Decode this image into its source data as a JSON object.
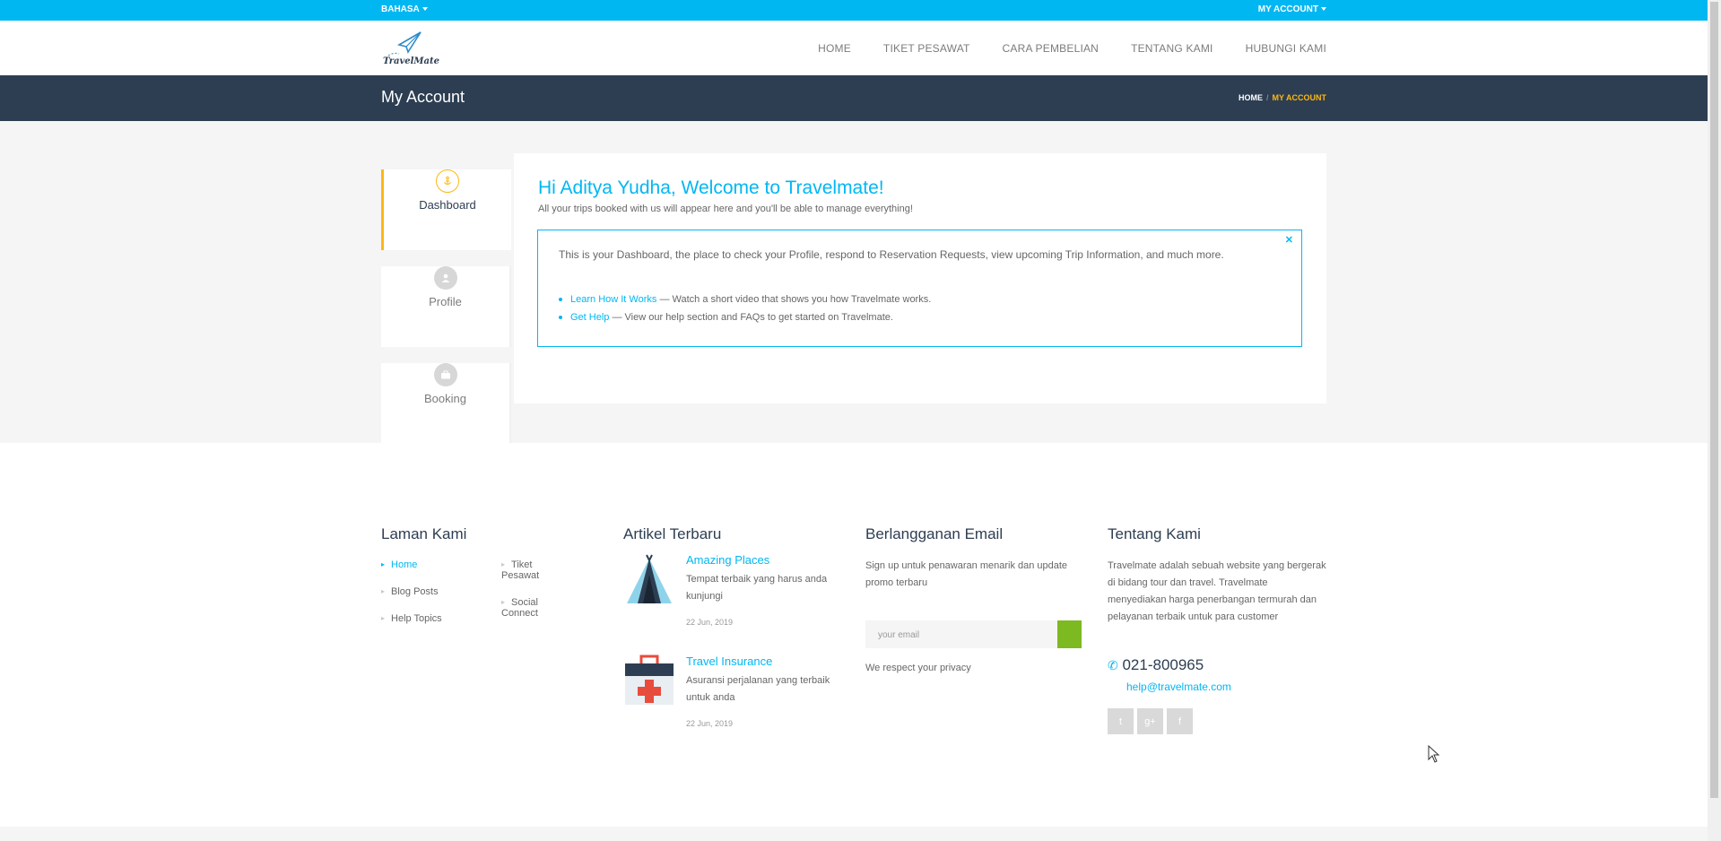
{
  "topbar": {
    "language": "BAHASA",
    "account": "MY ACCOUNT"
  },
  "header": {
    "logo_text": "TravelMate",
    "nav": [
      "HOME",
      "TIKET PESAWAT",
      "CARA PEMBELIAN",
      "TENTANG KAMI",
      "HUBUNGI KAMI"
    ]
  },
  "titlebar": {
    "title": "My Account",
    "breadcrumb_home": "HOME",
    "breadcrumb_current": "MY ACCOUNT"
  },
  "tabs": [
    {
      "label": "Dashboard",
      "icon": "anchor-icon",
      "active": true
    },
    {
      "label": "Profile",
      "icon": "user-icon",
      "active": false
    },
    {
      "label": "Booking",
      "icon": "briefcase-icon",
      "active": false
    }
  ],
  "dashboard": {
    "greeting": "Hi Aditya Yudha, Welcome to Travelmate!",
    "subtitle": "All your trips booked with us will appear here and you'll be able to manage everything!",
    "notice_text": "This is your Dashboard, the place to check your Profile, respond to Reservation Requests, view upcoming Trip Information, and much more.",
    "notice_items": [
      {
        "link": "Learn How It Works",
        "text": " — Watch a short video that shows you how Travelmate works."
      },
      {
        "link": "Get Help",
        "text": " — View our help section and FAQs to get started on Travelmate."
      }
    ]
  },
  "footer": {
    "pages_title": "Laman Kami",
    "pages_col1": [
      "Home",
      "Blog Posts",
      "Help Topics"
    ],
    "pages_col2": [
      "Tiket Pesawat",
      "Social Connect"
    ],
    "articles_title": "Artikel Terbaru",
    "articles": [
      {
        "title": "Amazing Places",
        "desc": "Tempat terbaik yang harus anda kunjungi",
        "date": "22 Jun, 2019"
      },
      {
        "title": "Travel Insurance",
        "desc": "Asuransi perjalanan yang terbaik untuk anda",
        "date": "22 Jun, 2019"
      }
    ],
    "newsletter_title": "Berlangganan Email",
    "newsletter_desc": "Sign up untuk penawaran menarik dan update promo terbaru",
    "email_placeholder": "your email",
    "privacy": "We respect your privacy",
    "about_title": "Tentang Kami",
    "about_desc": "Travelmate adalah sebuah website yang bergerak di bidang tour dan travel. Travelmate menyediakan harga penerbangan termurah dan pelayanan terbaik untuk para customer",
    "phone": "021-800965",
    "email": "help@travelmate.com",
    "social": [
      "twitter-icon",
      "googleplus-icon",
      "facebook-icon"
    ]
  },
  "colors": {
    "accent": "#01b7f2",
    "dark": "#2d3e52",
    "highlight": "#fdb714",
    "green": "#7db921"
  }
}
